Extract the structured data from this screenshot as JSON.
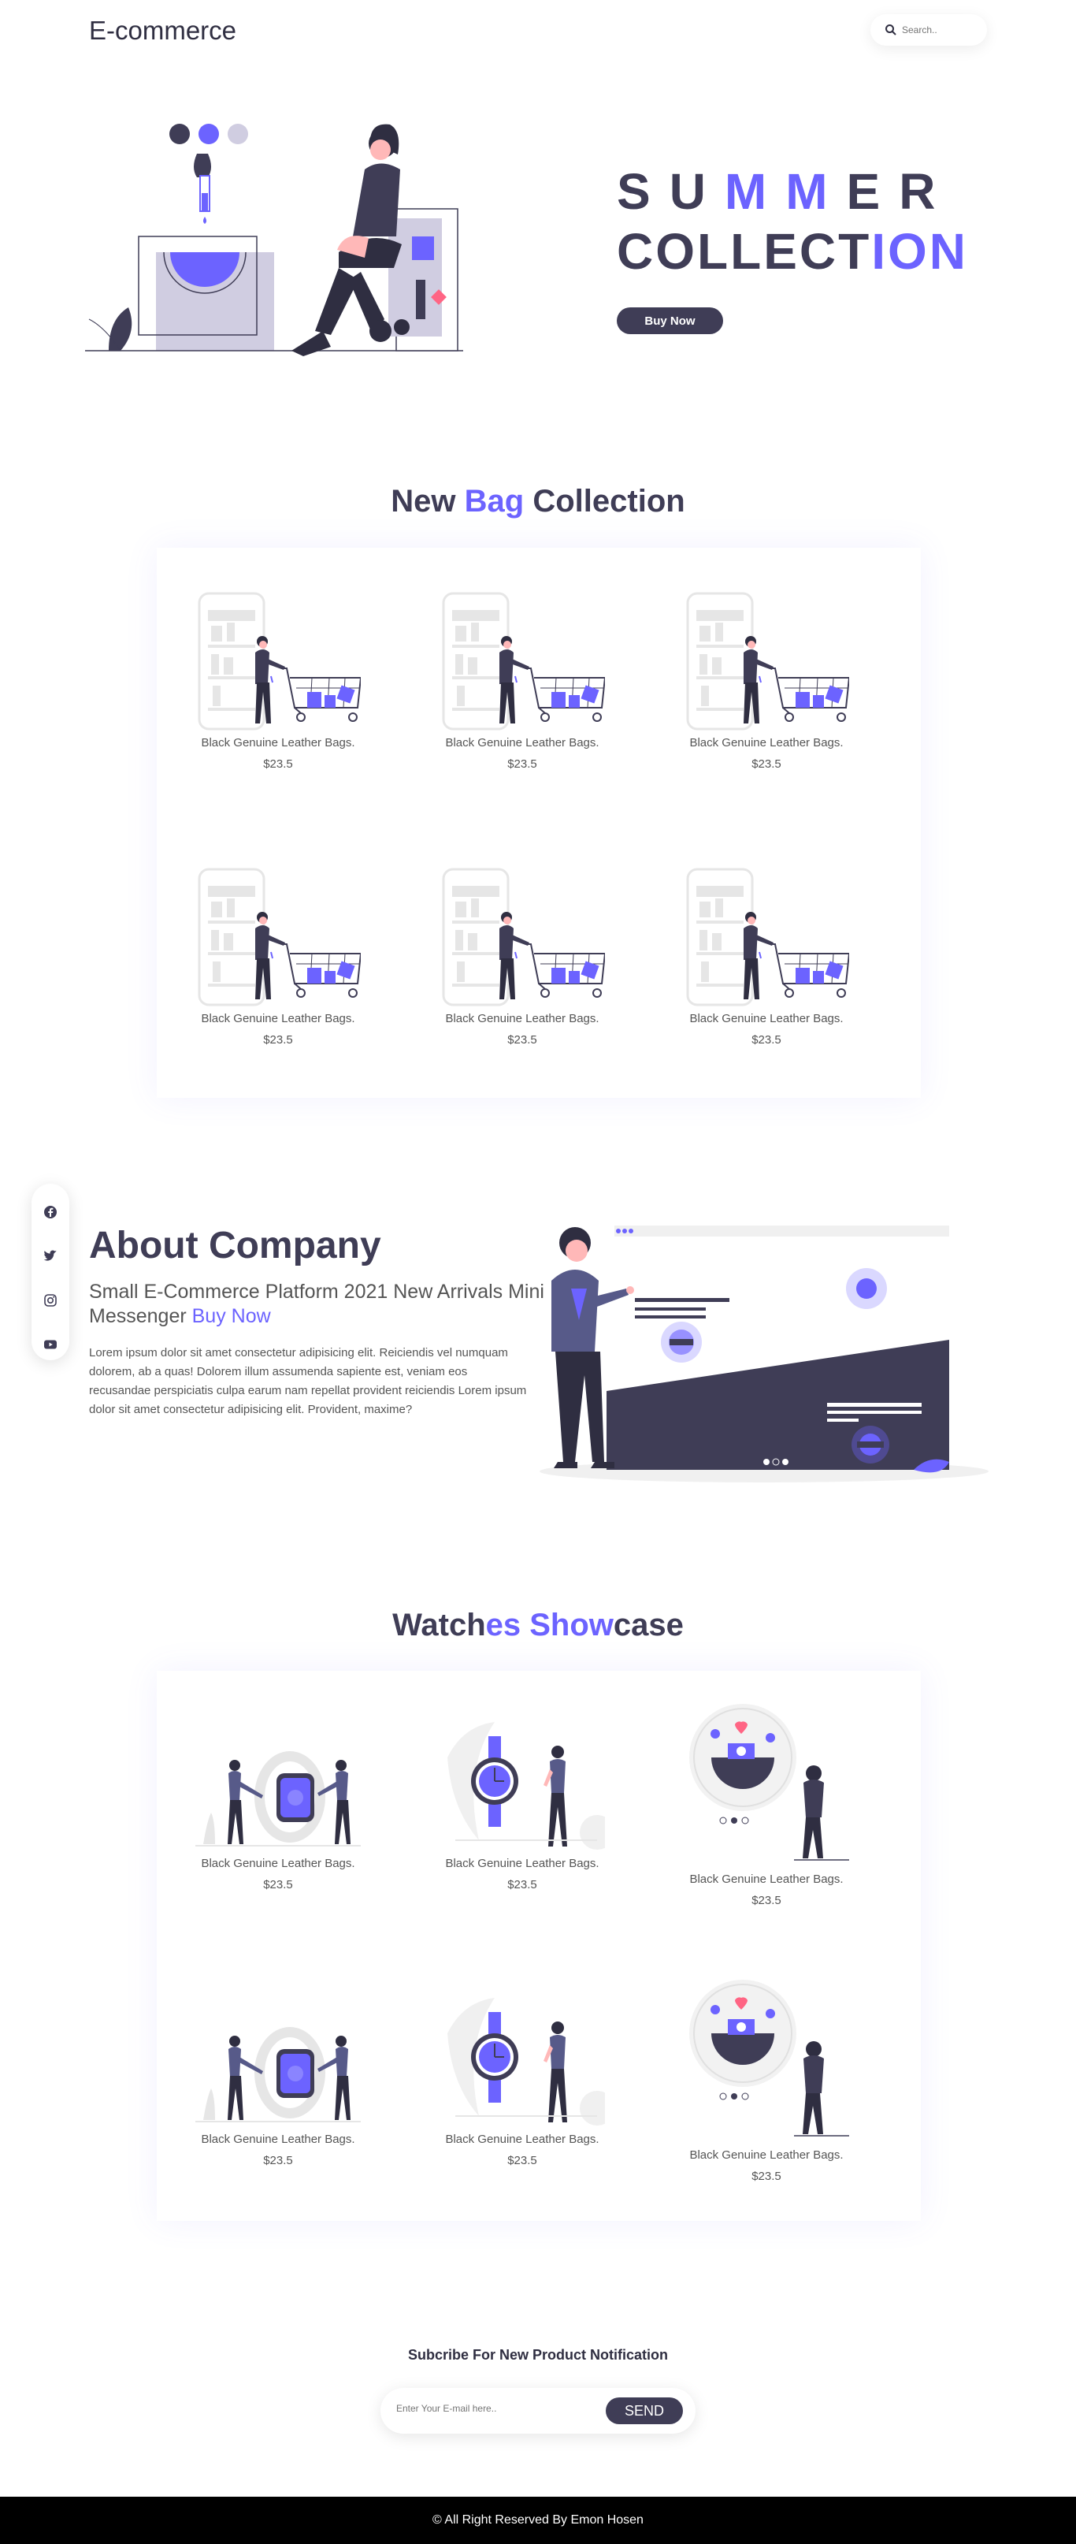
{
  "header": {
    "logo": "E-commerce",
    "search_placeholder": "Search.."
  },
  "hero": {
    "title_line1_pre": "SU",
    "title_line1_accent": "MM",
    "title_line1_post": "ER",
    "title_line2_pre": "COLLECT",
    "title_line2_accent": "ION",
    "buy_button": "Buy Now"
  },
  "bags": {
    "title_pre": "New ",
    "title_accent": "Bag",
    "title_post": " Collection",
    "products": [
      {
        "name": "Black Genuine Leather Bags.",
        "price": "$23.5"
      },
      {
        "name": "Black Genuine Leather Bags.",
        "price": "$23.5"
      },
      {
        "name": "Black Genuine Leather Bags.",
        "price": "$23.5"
      },
      {
        "name": "Black Genuine Leather Bags.",
        "price": "$23.5"
      },
      {
        "name": "Black Genuine Leather Bags.",
        "price": "$23.5"
      },
      {
        "name": "Black Genuine Leather Bags.",
        "price": "$23.5"
      }
    ]
  },
  "social": [
    "facebook-icon",
    "twitter-icon",
    "instagram-icon",
    "youtube-icon"
  ],
  "about": {
    "title": "About Company",
    "subtitle": "Small E-Commerce Platform 2021 New Arrivals Mini Messenger",
    "subtitle_link": "Buy Now",
    "text": "Lorem ipsum dolor sit amet consectetur adipisicing elit. Reiciendis vel numquam dolorem, ab a quas! Dolorem illum assumenda sapiente est, veniam eos recusandae perspiciatis culpa earum nam repellat provident reiciendis Lorem ipsum dolor sit amet consectetur adipisicing elit. Provident, maxime?"
  },
  "watches": {
    "title_pre": "Watch",
    "title_accent": "es Show",
    "title_post": "case",
    "products": [
      {
        "name": "Black Genuine Leather Bags.",
        "price": "$23.5"
      },
      {
        "name": "Black Genuine Leather Bags.",
        "price": "$23.5"
      },
      {
        "name": "Black Genuine Leather Bags.",
        "price": "$23.5"
      },
      {
        "name": "Black Genuine Leather Bags.",
        "price": "$23.5"
      },
      {
        "name": "Black Genuine Leather Bags.",
        "price": "$23.5"
      },
      {
        "name": "Black Genuine Leather Bags.",
        "price": "$23.5"
      }
    ]
  },
  "subscribe": {
    "title": "Subcribe For New Product Notification",
    "placeholder": "Enter Your E-mail here..",
    "button": "SEND"
  },
  "footer": {
    "text": "© All Right Reserved By Emon Hosen"
  },
  "colors": {
    "accent": "#6c63ff",
    "dark": "#3f3d56",
    "footer_bg": "#000000"
  }
}
